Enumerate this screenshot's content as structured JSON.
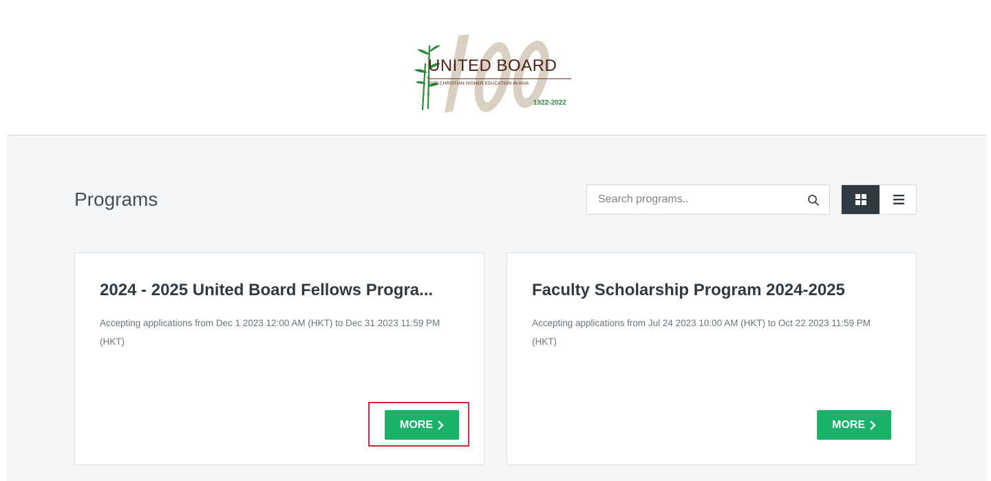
{
  "header": {
    "logo": {
      "title": "UNITED BOARD",
      "subtitle": "FOR CHRISTIAN HIGHER EDUCATION IN ASIA",
      "years": "1922-2022",
      "watermark": "100",
      "icon": "bamboo-icon"
    }
  },
  "main": {
    "title": "Programs",
    "search": {
      "placeholder": "Search programs..",
      "value": "",
      "icon": "search-icon"
    },
    "view_toggle": {
      "options": [
        {
          "name": "grid",
          "icon": "grid-icon",
          "active": true
        },
        {
          "name": "list",
          "icon": "list-icon",
          "active": false
        }
      ]
    },
    "programs": [
      {
        "title": "2024 - 2025 United Board Fellows Progra...",
        "description": "Accepting applications from Dec 1 2023 12:00 AM (HKT) to Dec 31 2023 11:59 PM (HKT)",
        "button_label": "MORE",
        "button_icon": "chevron-right-icon",
        "highlighted": true
      },
      {
        "title": "Faculty Scholarship Program 2024-2025",
        "description": "Accepting applications from Jul 24 2023 10:00 AM (HKT) to Oct 22 2023 11:59 PM (HKT)",
        "button_label": "MORE",
        "button_icon": "chevron-right-icon",
        "highlighted": false
      }
    ]
  },
  "colors": {
    "accent_green": "#18b26b",
    "toggle_active": "#2f3a43",
    "highlight_red": "#d9263a",
    "logo_brown": "#4b2415",
    "logo_green": "#2f8a3c"
  }
}
